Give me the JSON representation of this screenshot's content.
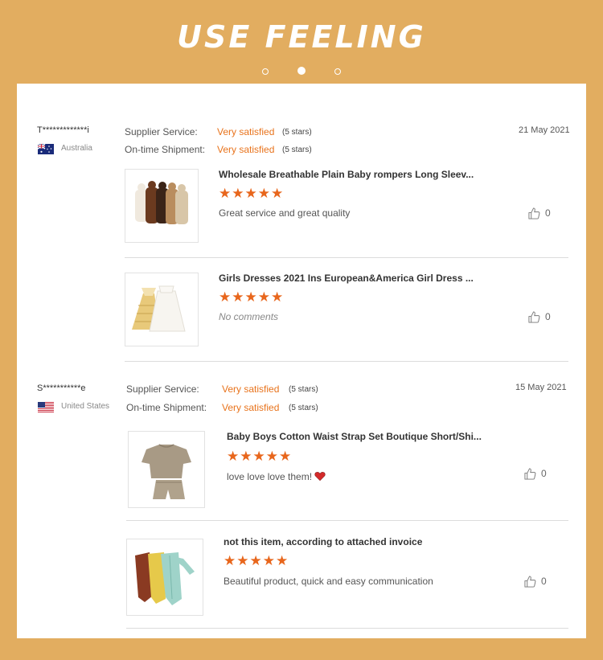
{
  "header": {
    "title": "USE FEELING"
  },
  "reviews": [
    {
      "user": "T*************i",
      "country": "Australia",
      "supplier_label": "Supplier Service:",
      "supplier_value": "Very satisfied",
      "supplier_stars": "(5 stars)",
      "shipment_label": "On-time Shipment:",
      "shipment_value": "Very satisfied",
      "shipment_stars": "(5 stars)",
      "date": "21 May 2021",
      "products": [
        {
          "title": "Wholesale Breathable Plain Baby rompers Long Sleev...",
          "stars": "★★★★★",
          "comment": "Great service and great quality",
          "likes": "0"
        },
        {
          "title": "Girls Dresses 2021 Ins European&America Girl Dress ...",
          "stars": "★★★★★",
          "comment": "No comments",
          "likes": "0"
        }
      ]
    },
    {
      "user": "S***********e",
      "country": "United States",
      "supplier_label": "Supplier Service:",
      "supplier_value": "Very satisfied",
      "supplier_stars": "(5 stars)",
      "shipment_label": "On-time Shipment:",
      "shipment_value": "Very satisfied",
      "shipment_stars": "(5 stars)",
      "date": "15 May 2021",
      "products": [
        {
          "title": "Baby Boys Cotton Waist Strap Set Boutique Short/Shi...",
          "stars": "★★★★★",
          "comment": "love love love them!",
          "likes": "0"
        },
        {
          "title": "not this item, according to attached invoice",
          "stars": "★★★★★",
          "comment": "Beautiful product, quick and easy communication",
          "likes": "0"
        }
      ]
    }
  ],
  "colors": {
    "background": "#e2ad60",
    "accent": "#e8661c",
    "card": "#ffffff"
  },
  "icons": {
    "like": "thumbs-up-icon",
    "heart": "heart-icon"
  }
}
